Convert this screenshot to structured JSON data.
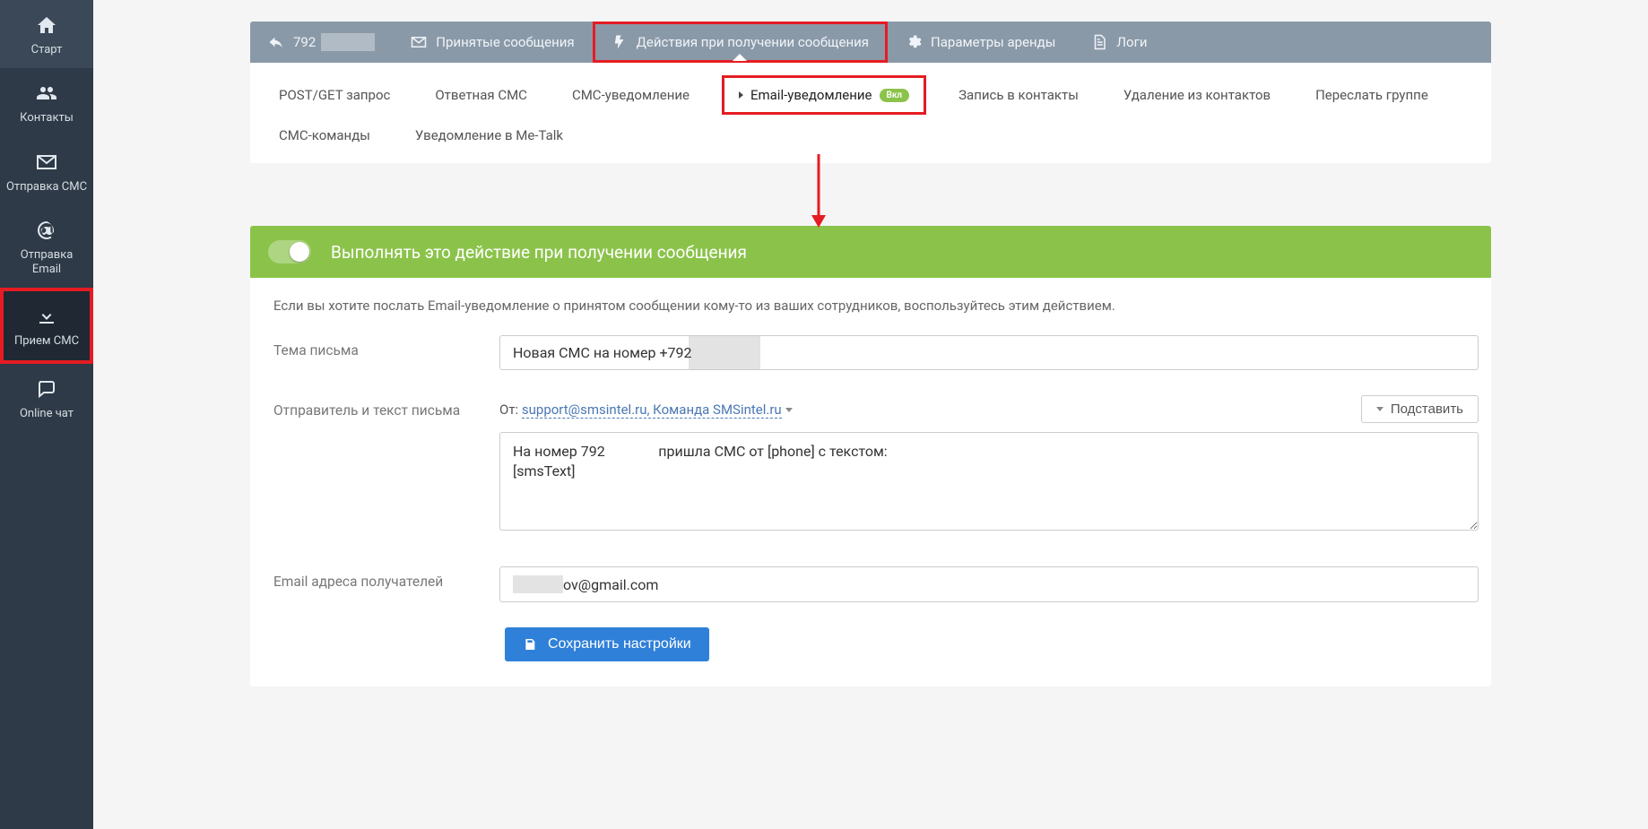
{
  "sidebar": {
    "items": [
      {
        "label": "Старт",
        "icon": "home-icon"
      },
      {
        "label": "Контакты",
        "icon": "users-icon"
      },
      {
        "label": "Отправка СМС",
        "icon": "envelope-icon"
      },
      {
        "label": "Отправка Email",
        "icon": "at-icon"
      },
      {
        "label": "Прием СМС",
        "icon": "download-icon"
      },
      {
        "label": "Online чат",
        "icon": "chat-icon"
      }
    ]
  },
  "top_nav": {
    "items": [
      {
        "label": "792",
        "icon": "reply-icon"
      },
      {
        "label": "Принятые сообщения",
        "icon": "envelope-icon"
      },
      {
        "label": "Действия при получении сообщения",
        "icon": "bolt-icon"
      },
      {
        "label": "Параметры аренды",
        "icon": "gear-icon"
      },
      {
        "label": "Логи",
        "icon": "file-icon"
      }
    ]
  },
  "sub_tabs": {
    "items": [
      "POST/GET запрос",
      "Ответная СМС",
      "СМС-уведомление",
      "Email-уведомление",
      "Запись в контакты",
      "Удаление из контактов",
      "Переслать группе",
      "СМС-команды",
      "Уведомление в Me-Talk"
    ],
    "badge_on": "Вкл"
  },
  "panel": {
    "toggle_label": "Выполнять это действие при получении сообщения",
    "helper": "Если вы хотите послать Email-уведомление о принятом сообщении кому-то из ваших сотрудников, воспользуйтесь этим действием.",
    "subject_label": "Тема письма",
    "subject_value": "Новая СМС на номер +792",
    "sender_label": "Отправитель и текст письма",
    "from_prefix": "От: ",
    "from_link": "support@smsintel.ru, Команда SMSintel.ru",
    "insert_btn": "Подставить",
    "body_value": "На номер 792               пришла СМС от [phone] с текстом:\n[smsText]",
    "recipients_label": "Email адреса получателей",
    "recipients_value": "ov@gmail.com",
    "save_label": "Сохранить настройки"
  }
}
